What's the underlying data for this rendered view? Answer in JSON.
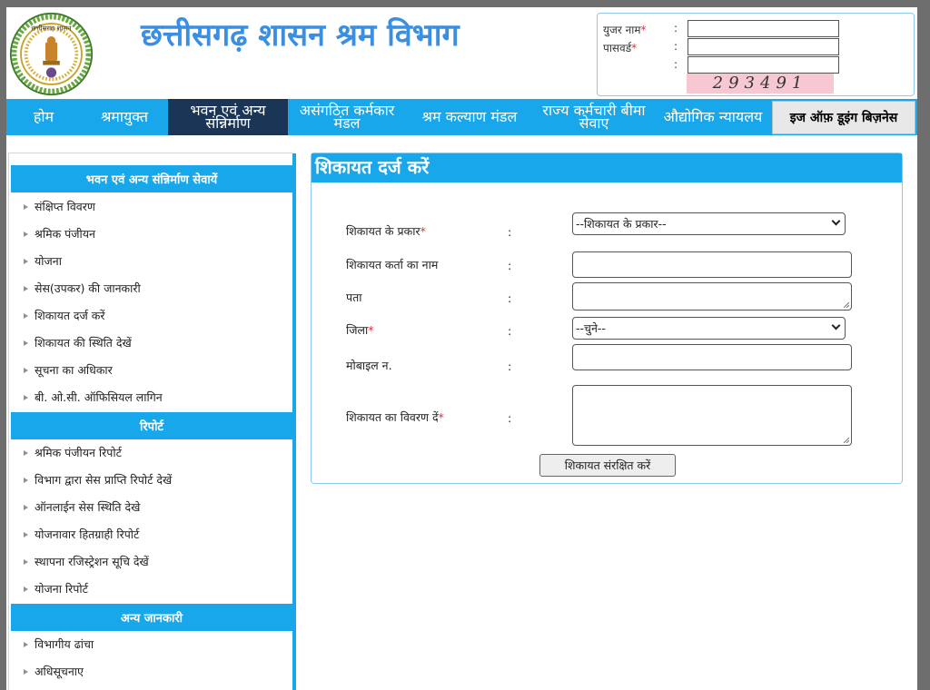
{
  "header": {
    "title": "छत्तीसगढ़ शासन श्रम विभाग",
    "emblem_text": "छत्तीसगढ़ शासन",
    "login": {
      "username_label": "युजर नाम",
      "password_label": "पासवर्ड",
      "required_mark": "*",
      "colon": ":",
      "captcha": "293491"
    }
  },
  "nav": {
    "items": [
      {
        "label": "होम"
      },
      {
        "label": "श्रमायुक्त"
      },
      {
        "label": "भवन एवं अन्य संन्निर्माण"
      },
      {
        "label": "असंगठित कर्मकार मंडल"
      },
      {
        "label": "श्रम कल्याण मंडल"
      },
      {
        "label": "राज्य कर्मचारी बीमा सेवाए"
      },
      {
        "label": "औद्योगिक न्यायलय"
      },
      {
        "label": "इज ऑफ़ डूइंग बिज़नेस"
      }
    ]
  },
  "sidebar": {
    "section1": {
      "title": "भवन एवं अन्य संन्निर्माण सेवायें",
      "items": [
        "संक्षिप्त विवरण",
        "श्रमिक पंजीयन",
        "योजना",
        "सेस(उपकर) की जानकारी",
        "शिकायत दर्ज करें",
        "शिकायत की स्थिति देखें",
        "सूचना का अधिकार",
        "बी. ओ.सी. ऑफिसियल लागिन"
      ]
    },
    "section2": {
      "title": "रिपोर्ट",
      "items": [
        "श्रमिक पंजीयन रिपोर्ट",
        "विभाग द्वारा सेस प्राप्ति रिपोर्ट देखें",
        "ऑनलाईन सेस स्थिति देखे",
        "योजनावार हितग्राही रिपोर्ट",
        "स्थापना रजिस्ट्रेशन सूचि देखें",
        "योजना रिपोर्ट"
      ]
    },
    "section3": {
      "title": "अन्य जानकारी",
      "items": [
        "विभागीय ढांचा",
        "अधिसूचनाए"
      ]
    }
  },
  "form": {
    "title": "शिकायत दर्ज करें",
    "colon": ":",
    "required_mark": "*",
    "complaint_type_label": "शिकायत के प्रकार",
    "complaint_type_value": "--शिकायत के प्रकार--",
    "complainant_name_label": "शिकायत कर्ता का नाम",
    "address_label": "पता",
    "district_label": "जिला",
    "district_value": "--चुने--",
    "mobile_label": "मोबाइल न.",
    "details_label": "शिकायत का विवरण दें",
    "submit_label": "शिकायत संरक्षित करें"
  }
}
